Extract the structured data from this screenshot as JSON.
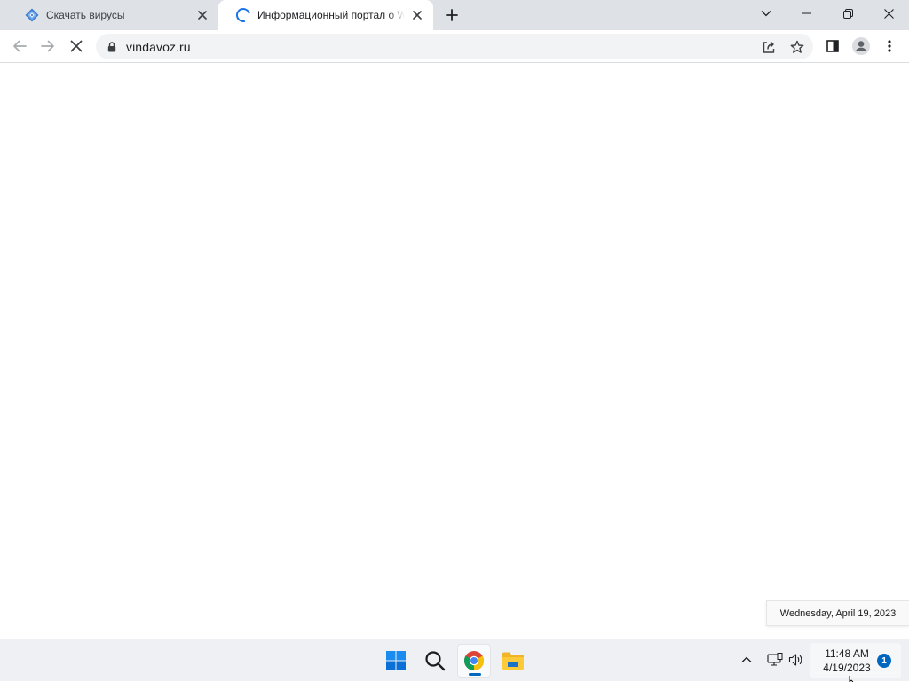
{
  "browser": {
    "tabs": [
      {
        "title": "Скачать вирусы",
        "favicon": "diamond-logo-icon",
        "state": "inactive"
      },
      {
        "title": "Информационный портал о Windows",
        "favicon": "loading-spinner-icon",
        "state": "active"
      }
    ],
    "omnibox": {
      "url": "vindavoz.ru"
    },
    "accent_color": "#1a73e8"
  },
  "tooltip": {
    "text": "Wednesday, April 19, 2023"
  },
  "taskbar": {
    "apps": [
      "windows-start",
      "search",
      "chrome",
      "file-explorer"
    ],
    "clock": {
      "time": "11:48 AM",
      "date": "4/19/2023"
    },
    "notifications_count": "1",
    "accent_color": "#0067c0"
  }
}
